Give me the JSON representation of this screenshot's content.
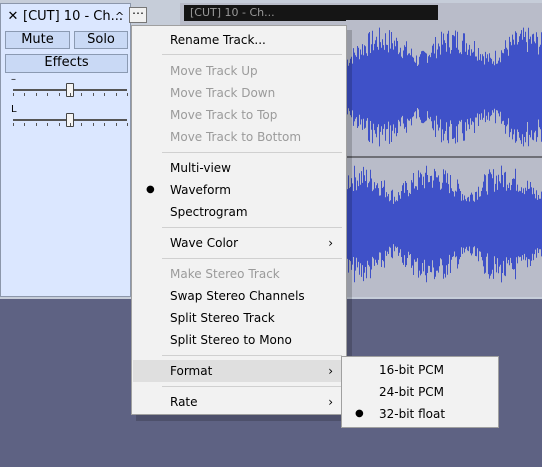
{
  "track": {
    "close_symbol": "✕",
    "name": "[CUT] 10 - Ch...",
    "collapse_symbol": "^",
    "menu_button": "⋯",
    "mute_label": "Mute",
    "solo_label": "Solo",
    "effects_label": "Effects",
    "gain_label": "–",
    "pan_label": "L",
    "gain_level": 0.5,
    "pan_level": 0.5
  },
  "clip": {
    "title": "[CUT] 10 - Ch..."
  },
  "colors": {
    "waveform": "#3f51c8",
    "waveform_background": "#b9bcc9",
    "track_panel": "#dbe7ff",
    "workspace": "#5e6283"
  },
  "context_menu": {
    "items": [
      {
        "label": "Rename Track...",
        "enabled": true
      },
      {
        "label": "Move Track Up",
        "enabled": false
      },
      {
        "label": "Move Track Down",
        "enabled": false
      },
      {
        "label": "Move Track to Top",
        "enabled": false
      },
      {
        "label": "Move Track to Bottom",
        "enabled": false
      },
      {
        "label": "Multi-view",
        "enabled": true
      },
      {
        "label": "Waveform",
        "enabled": true,
        "checked": true
      },
      {
        "label": "Spectrogram",
        "enabled": true
      },
      {
        "label": "Wave Color",
        "enabled": true,
        "submenu": true
      },
      {
        "label": "Make Stereo Track",
        "enabled": false
      },
      {
        "label": "Swap Stereo Channels",
        "enabled": true
      },
      {
        "label": "Split Stereo Track",
        "enabled": true
      },
      {
        "label": "Split Stereo to Mono",
        "enabled": true
      },
      {
        "label": "Format",
        "enabled": true,
        "submenu": true,
        "highlighted": true
      },
      {
        "label": "Rate",
        "enabled": true,
        "submenu": true
      }
    ],
    "check_symbol": "●",
    "submenu_arrow": "›"
  },
  "format_submenu": {
    "items": [
      {
        "label": "16-bit PCM",
        "checked": false
      },
      {
        "label": "24-bit PCM",
        "checked": false
      },
      {
        "label": "32-bit float",
        "checked": true
      }
    ]
  }
}
